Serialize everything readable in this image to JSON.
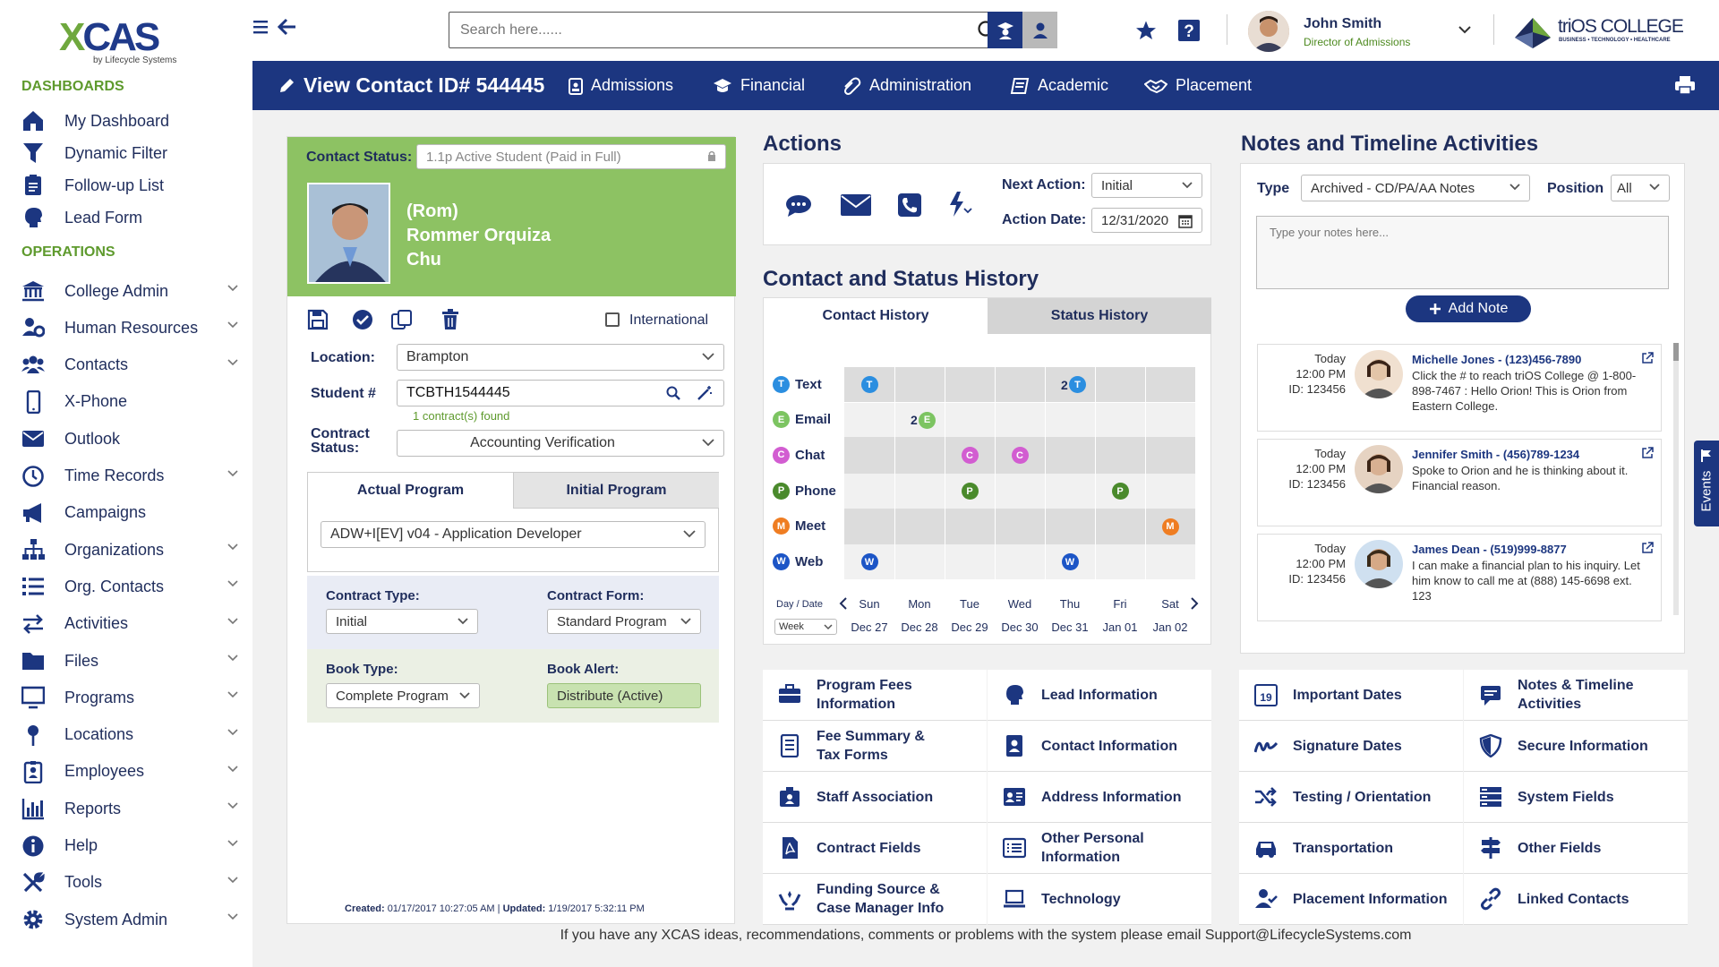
{
  "logo": {
    "brand": "XCAS",
    "byline": "by Lifecycle Systems"
  },
  "sidebar": {
    "dashboards_heading": "DASHBOARDS",
    "dashboards": [
      {
        "label": "My Dashboard",
        "icon": "home-icon"
      },
      {
        "label": "Dynamic Filter",
        "icon": "filter-icon"
      },
      {
        "label": "Follow-up List",
        "icon": "clipboard-icon"
      },
      {
        "label": "Lead Form",
        "icon": "head-icon"
      }
    ],
    "operations_heading": "OPERATIONS",
    "operations": [
      {
        "label": "College Admin",
        "icon": "building-icon"
      },
      {
        "label": "Human Resources",
        "icon": "users-cog-icon"
      },
      {
        "label": "Contacts",
        "icon": "users-icon"
      },
      {
        "label": "X-Phone",
        "icon": "mobile-icon"
      },
      {
        "label": "Outlook",
        "icon": "envelope-icon"
      },
      {
        "label": "Time Records",
        "icon": "clock-icon"
      },
      {
        "label": "Campaigns",
        "icon": "megaphone-icon"
      },
      {
        "label": "Organizations",
        "icon": "sitemap-icon"
      },
      {
        "label": "Org. Contacts",
        "icon": "list-icon"
      },
      {
        "label": "Activities",
        "icon": "exchange-icon"
      },
      {
        "label": "Files",
        "icon": "folder-icon"
      },
      {
        "label": "Programs",
        "icon": "monitor-icon"
      },
      {
        "label": "Locations",
        "icon": "pin-icon"
      },
      {
        "label": "Employees",
        "icon": "badge-icon"
      },
      {
        "label": "Reports",
        "icon": "bar-chart-icon"
      },
      {
        "label": "Help",
        "icon": "info-icon"
      },
      {
        "label": "Tools",
        "icon": "tools-icon"
      },
      {
        "label": "System Admin",
        "icon": "gear-icon"
      }
    ]
  },
  "topbar": {
    "search_placeholder": "Search here......",
    "user_name": "John Smith",
    "user_role": "Director of Admissions",
    "college_brand": "triOS COLLEGE",
    "college_tagline": "BUSINESS • TECHNOLOGY • HEALTHCARE"
  },
  "nav": {
    "title": "View Contact ID# 544445",
    "tabs": [
      "Admissions",
      "Financial",
      "Administration",
      "Academic",
      "Placement"
    ]
  },
  "contact": {
    "status_label": "Contact Status:",
    "status_value": "1.1p Active Student (Paid in Full)",
    "name_line1": "(Rom)",
    "name_line2": "Rommer Orquiza",
    "name_line3": "Chu",
    "international_label": "International",
    "location_label": "Location:",
    "location_value": "Brampton",
    "student_label": "Student #",
    "student_value": "TCBTH1544445",
    "contracts_found": "1 contract(s) found",
    "contract_status_label_1": "Contract",
    "contract_status_label_2": "Status:",
    "contract_status_value": "Accounting Verification",
    "program_tabs": [
      "Actual Program",
      "Initial Program"
    ],
    "program_value": "ADW+I[EV] v04 - Application Developer",
    "contract_type_label": "Contract Type:",
    "contract_type_value": "Initial",
    "contract_form_label": "Contract Form:",
    "contract_form_value": "Standard Program",
    "book_type_label": "Book Type:",
    "book_type_value": "Complete Program",
    "book_alert_label": "Book Alert:",
    "book_alert_value": "Distribute (Active)",
    "created_label": "Created:",
    "created_value": "01/17/2017 10:27:05 AM",
    "updated_label": "Updated:",
    "updated_value": "1/19/2017 5:32:11 PM"
  },
  "actions": {
    "heading": "Actions",
    "next_action_label": "Next Action:",
    "next_action_value": "Initial",
    "action_date_label": "Action Date:",
    "action_date_value": "12/31/2020"
  },
  "history": {
    "heading": "Contact and Status History",
    "tabs": [
      "Contact History",
      "Status History"
    ],
    "rows": [
      {
        "label": "Text",
        "letter": "T",
        "color": "#2b8ee0"
      },
      {
        "label": "Email",
        "letter": "E",
        "color": "#7cc461"
      },
      {
        "label": "Chat",
        "letter": "C",
        "color": "#d25dd1"
      },
      {
        "label": "Phone",
        "letter": "P",
        "color": "#4a8a2c"
      },
      {
        "label": "Meet",
        "letter": "M",
        "color": "#ef7d22"
      },
      {
        "label": "Web",
        "letter": "W",
        "color": "#1c55c6"
      }
    ],
    "day_date_label": "Day / Date",
    "range_value": "Week",
    "days": [
      "Sun",
      "Mon",
      "Tue",
      "Wed",
      "Thu",
      "Fri",
      "Sat"
    ],
    "dates": [
      "Dec 27",
      "Dec 28",
      "Dec 29",
      "Dec 30",
      "Dec 31",
      "Jan 01",
      "Jan 02"
    ],
    "marks": [
      {
        "row": 0,
        "col": 0,
        "count": ""
      },
      {
        "row": 0,
        "col": 4,
        "count": "2"
      },
      {
        "row": 1,
        "col": 1,
        "count": "2"
      },
      {
        "row": 2,
        "col": 2,
        "count": ""
      },
      {
        "row": 2,
        "col": 3,
        "count": ""
      },
      {
        "row": 3,
        "col": 2,
        "count": ""
      },
      {
        "row": 3,
        "col": 5,
        "count": ""
      },
      {
        "row": 4,
        "col": 6,
        "count": ""
      },
      {
        "row": 5,
        "col": 0,
        "count": ""
      },
      {
        "row": 5,
        "col": 4,
        "count": ""
      }
    ]
  },
  "notes": {
    "heading": "Notes and Timeline Activities",
    "type_label": "Type",
    "type_value": "Archived - CD/PA/AA Notes",
    "position_label": "Position",
    "position_value": "All",
    "textarea_placeholder": "Type your notes here...",
    "add_note_label": "Add Note",
    "items": [
      {
        "day": "Today",
        "time": "12:00 PM",
        "id": "ID: 123456",
        "who": "Michelle Jones - (123)456-7890",
        "text": "Click the # to reach triOS College @ 1-800-898-7467 : Hello Orion! This is Orion from Eastern College."
      },
      {
        "day": "Today",
        "time": "12:00 PM",
        "id": "ID: 123456",
        "who": "Jennifer Smith - (456)789-1234",
        "text": "Spoke to Orion and he is thinking about it. Financial reason."
      },
      {
        "day": "Today",
        "time": "12:00 PM",
        "id": "ID: 123456",
        "who": "James Dean - (519)999-8877",
        "text": "I can make a financial plan to his inquiry. Let him know to call me at (888) 145-6698 ext. 123"
      }
    ],
    "events_tab": "Events"
  },
  "tiles_left": [
    [
      "Program Fees",
      "Information"
    ],
    [
      "Lead Information"
    ],
    [
      "Fee Summary &",
      "Tax Forms"
    ],
    [
      "Contact Information"
    ],
    [
      "Staff Association"
    ],
    [
      "Address Information"
    ],
    [
      "Contract Fields"
    ],
    [
      "Other Personal",
      "Information"
    ],
    [
      "Funding Source &",
      "Case Manager Info"
    ],
    [
      "Technology"
    ]
  ],
  "tiles_right": [
    [
      "Important Dates"
    ],
    [
      "Notes & Timeline",
      "Activities"
    ],
    [
      "Signature Dates"
    ],
    [
      "Secure Information"
    ],
    [
      "Testing / Orientation"
    ],
    [
      "System Fields"
    ],
    [
      "Transportation"
    ],
    [
      "Other Fields"
    ],
    [
      "Placement Information"
    ],
    [
      "Linked Contacts"
    ]
  ],
  "footer": {
    "text": "If you have any XCAS ideas, recommendations, comments or problems with the system please email Support@LifecycleSystems.com"
  },
  "colors": {
    "brand_blue": "#1c3680",
    "brand_green": "#8dc263",
    "heading_green": "#5e9a2d"
  }
}
